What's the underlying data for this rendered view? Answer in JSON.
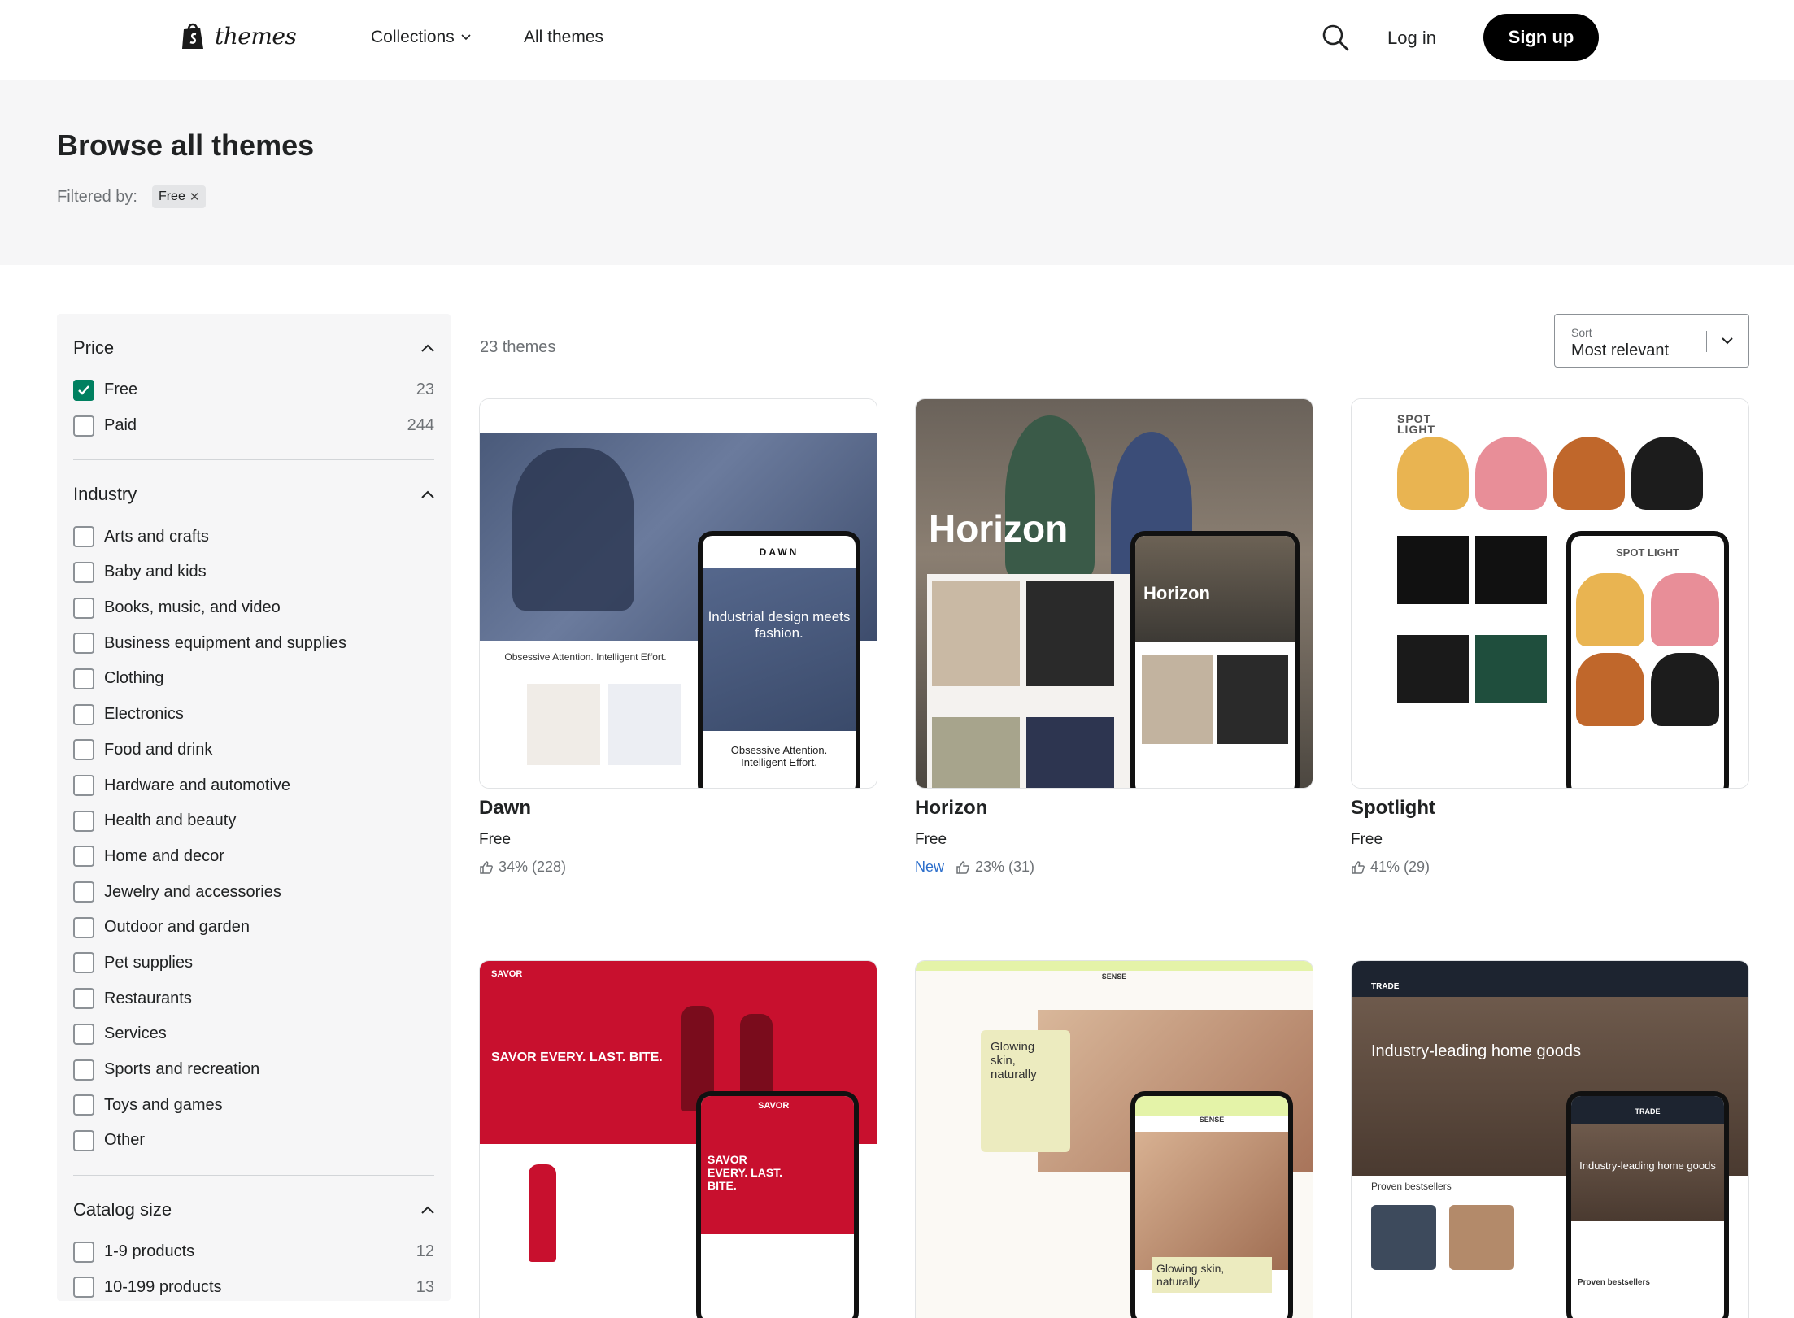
{
  "header": {
    "logo_text": "themes",
    "nav": {
      "collections": "Collections",
      "all_themes": "All themes"
    },
    "login": "Log in",
    "signup": "Sign up"
  },
  "hero": {
    "title": "Browse all themes",
    "filtered_by": "Filtered by:",
    "chip": "Free"
  },
  "sidebar": {
    "price": {
      "title": "Price",
      "options": [
        {
          "label": "Free",
          "count": "23",
          "checked": true
        },
        {
          "label": "Paid",
          "count": "244",
          "checked": false
        }
      ]
    },
    "industry": {
      "title": "Industry",
      "options": [
        "Arts and crafts",
        "Baby and kids",
        "Books, music, and video",
        "Business equipment and supplies",
        "Clothing",
        "Electronics",
        "Food and drink",
        "Hardware and automotive",
        "Health and beauty",
        "Home and decor",
        "Jewelry and accessories",
        "Outdoor and garden",
        "Pet supplies",
        "Restaurants",
        "Services",
        "Sports and recreation",
        "Toys and games",
        "Other"
      ]
    },
    "catalog": {
      "title": "Catalog size",
      "options": [
        {
          "label": "1-9 products",
          "count": "12"
        },
        {
          "label": "10-199 products",
          "count": "13"
        }
      ]
    }
  },
  "main": {
    "count": "23 themes",
    "sort": {
      "label": "Sort",
      "value": "Most relevant"
    },
    "themes": [
      {
        "name": "Dawn",
        "price": "Free",
        "rating": "34% (228)",
        "new": ""
      },
      {
        "name": "Horizon",
        "price": "Free",
        "rating": "23% (31)",
        "new": "New"
      },
      {
        "name": "Spotlight",
        "price": "Free",
        "rating": "41% (29)",
        "new": ""
      }
    ],
    "thumb_text": {
      "dawn_headline": "Industrial design meets fashion.",
      "dawn_sub": "Obsessive Attention. Intelligent Effort.",
      "dawn_brand": "DAWN",
      "horizon_headline": "Horizon",
      "spotlight_brand": "SPOT LIGHT",
      "savor_headline": "SAVOR EVERY. LAST. BITE.",
      "savor_brand": "SAVOR",
      "sense_headline": "Glowing skin, naturally",
      "sense_brand": "SENSE",
      "trade_headline": "Industry-leading home goods",
      "trade_brand": "TRADE",
      "trade_section": "Proven bestsellers"
    }
  },
  "colors": {
    "accent": "#008060",
    "link": "#2c6ecb",
    "hero_bg": "#f6f6f7",
    "savor_red": "#c8102e"
  }
}
